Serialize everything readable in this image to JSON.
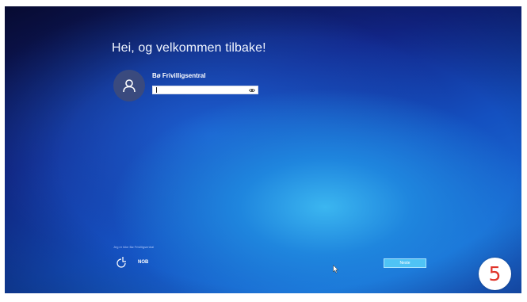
{
  "login": {
    "welcome_text": "Hei, og velkommen tilbake!",
    "account_name": "Bø Frivilligsentral",
    "password_value": "",
    "signin_other": "Jeg er ikke Bø Frivilligsentral",
    "language": "NOB",
    "next_label": "Neste"
  },
  "overlay": {
    "step_number": "5"
  },
  "colors": {
    "accent_button": "#4fc3f5",
    "step_badge_text": "#e0342a"
  },
  "icons": {
    "avatar": "user-icon",
    "reveal": "eye-icon",
    "accessibility": "ease-of-access-icon",
    "cursor": "mouse-pointer-icon"
  }
}
